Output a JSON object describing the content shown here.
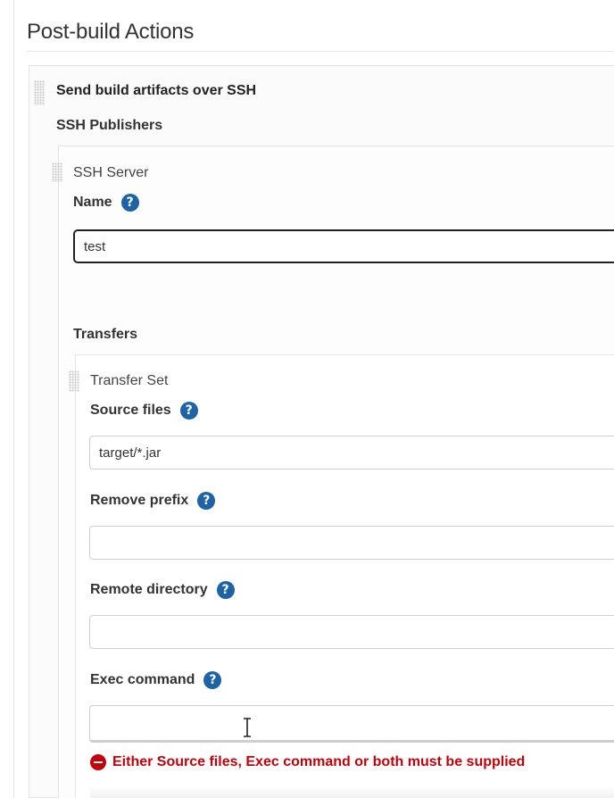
{
  "section_title": "Post-build Actions",
  "publisher": {
    "heading": "Send build artifacts over SSH",
    "publishers_label": "SSH Publishers",
    "server": {
      "group_label": "SSH Server",
      "name_label": "Name",
      "name_value": "test",
      "transfers_label": "Transfers",
      "transfer_set": {
        "group_label": "Transfer Set",
        "source_files_label": "Source files",
        "source_files_value": "target/*.jar",
        "remove_prefix_label": "Remove prefix",
        "remove_prefix_value": "",
        "remote_directory_label": "Remote directory",
        "remote_directory_value": "",
        "exec_command_label": "Exec command",
        "exec_command_value": "",
        "error_message": "Either Source files, Exec command or both must be supplied"
      }
    }
  },
  "help_icon_glyph": "?",
  "colors": {
    "help_icon": "#1d63a5",
    "error": "#c4000a"
  }
}
